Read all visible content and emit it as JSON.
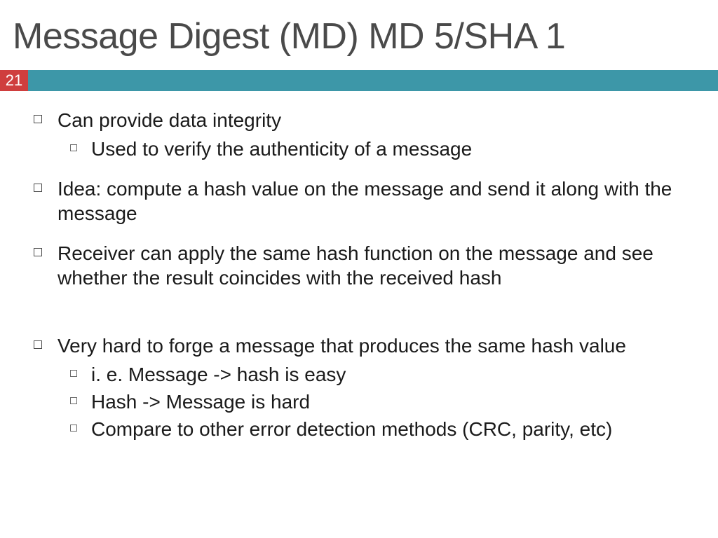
{
  "title": "Message Digest (MD) MD 5/SHA 1",
  "slideNumber": "21",
  "colors": {
    "accentRed": "#cf3e3e",
    "accentTeal": "#3d97a8",
    "titleGray": "#4a4a4a"
  },
  "bullets": [
    {
      "text": "Can provide data integrity",
      "sub": [
        "Used to verify the authenticity of a message"
      ],
      "gapAfter": "normal"
    },
    {
      "text": "Idea: compute a hash value on the message and send it along with the message",
      "sub": [],
      "gapAfter": "normal"
    },
    {
      "text": "Receiver can apply the same hash function on the message and see whether the result coincides with the received hash",
      "sub": [],
      "gapAfter": "large"
    },
    {
      "text": "Very hard to forge a message that produces the same hash value",
      "sub": [
        "i. e. Message -> hash is easy",
        "Hash -> Message is hard",
        "Compare to other error detection methods (CRC, parity, etc)"
      ],
      "gapAfter": "normal"
    }
  ]
}
